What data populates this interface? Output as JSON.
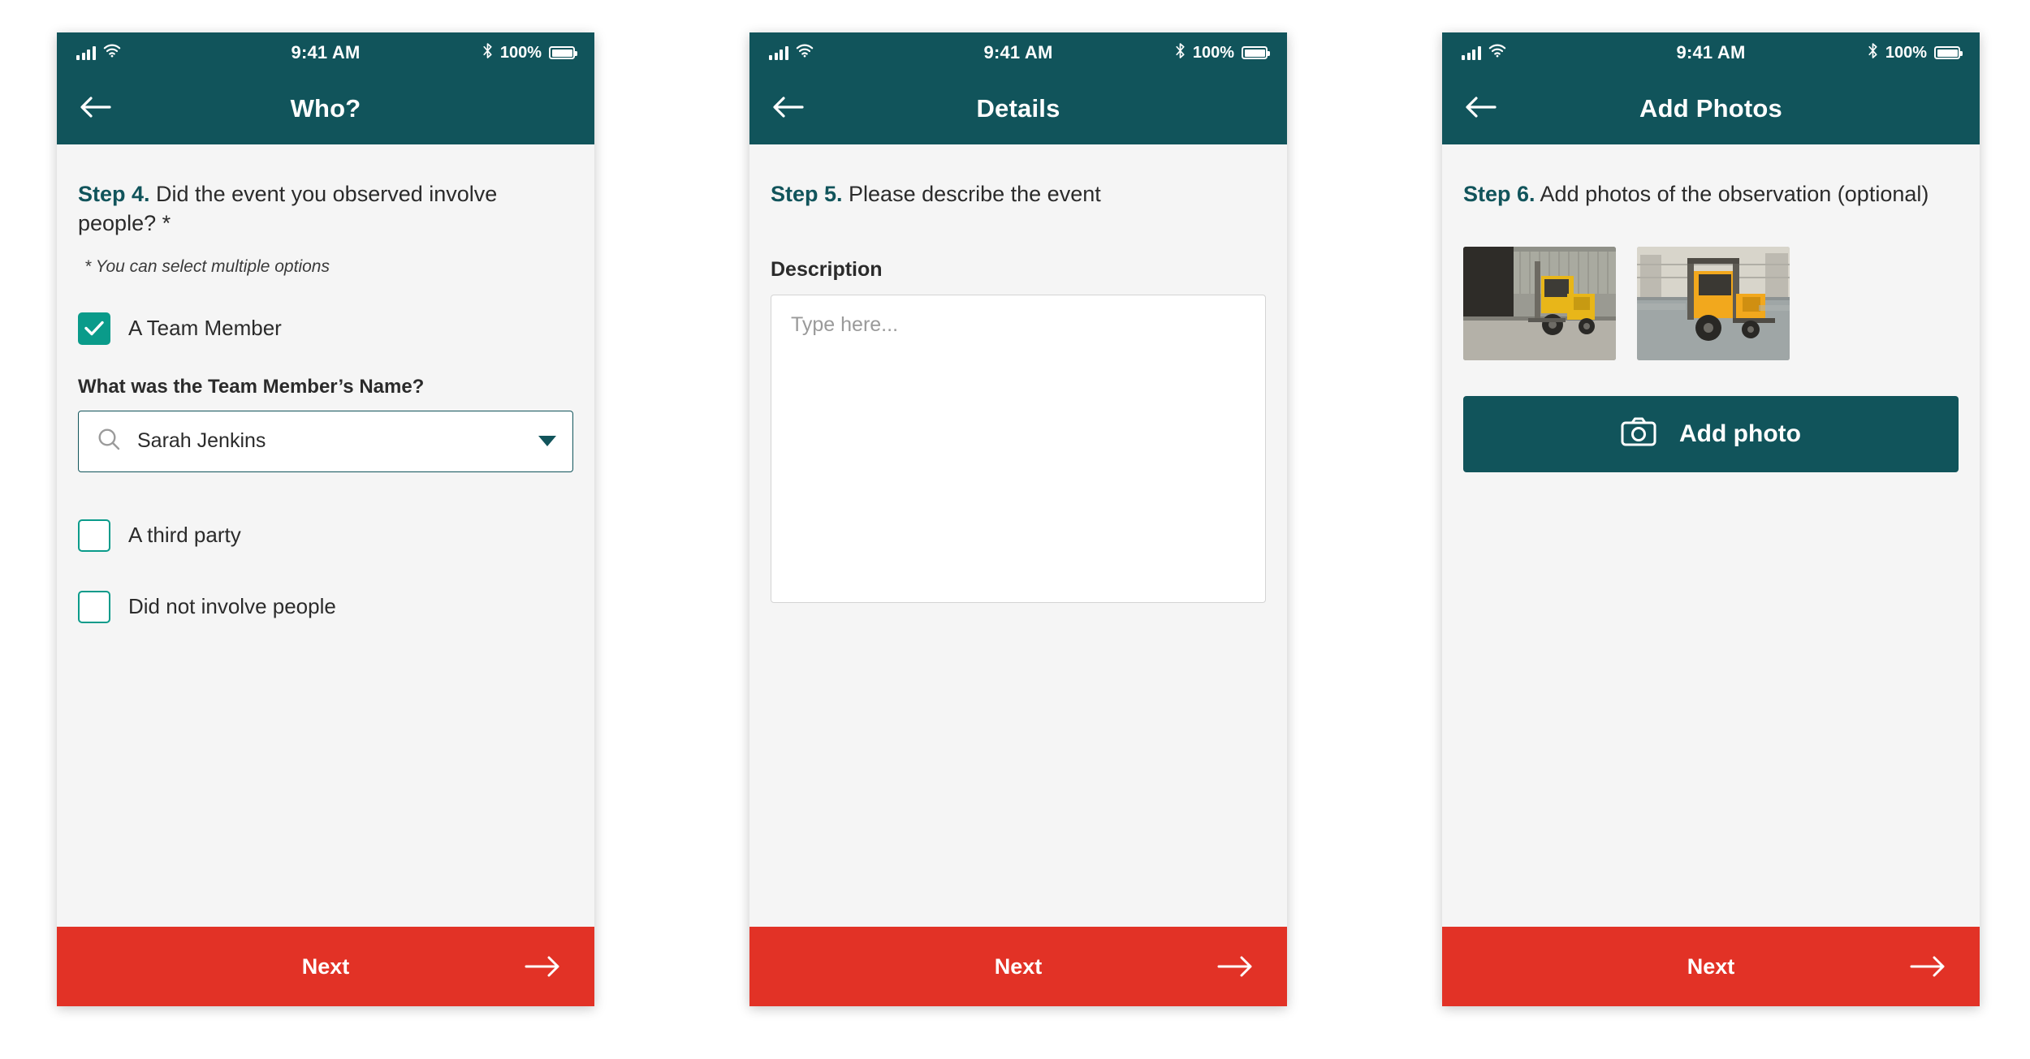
{
  "statusbar": {
    "time": "9:41 AM",
    "battery_percent": "100%",
    "icons": [
      "signal-bars-icon",
      "wifi-icon",
      "bluetooth-icon",
      "battery-icon"
    ]
  },
  "colors": {
    "header": "#11545b",
    "accent_teal": "#0a9b8a",
    "next_button": "#e23226",
    "body_bg": "#f5f5f5"
  },
  "common": {
    "next_label": "Next",
    "back_icon": "arrow-left-icon",
    "next_icon": "arrow-right-icon"
  },
  "screens": [
    {
      "title": "Who?",
      "step_num": "Step 4.",
      "step_text": " Did the event you observed involve people? *",
      "hint": "* You can select multiple options",
      "checkboxes": [
        {
          "label": "A Team Member",
          "checked": true
        },
        {
          "label": "A third party",
          "checked": false
        },
        {
          "label": "Did not involve people",
          "checked": false
        }
      ],
      "field_label": "What was the Team Member’s Name?",
      "select_value": "Sarah Jenkins",
      "select_icon": "search-icon",
      "select_caret": "chevron-down-icon"
    },
    {
      "title": "Details",
      "step_num": "Step 5.",
      "step_text": " Please describe the event",
      "desc_label": "Description",
      "desc_placeholder": "Type here..."
    },
    {
      "title": "Add Photos",
      "step_num": "Step 6.",
      "step_text": " Add photos of the observation (optional)",
      "photos": [
        {
          "name": "forklift-photo-1",
          "alt": "yellow forklift beside loading dock"
        },
        {
          "name": "forklift-photo-2",
          "alt": "yellow forklift inside warehouse"
        }
      ],
      "add_photo_label": "Add photo",
      "add_photo_icon": "camera-icon"
    }
  ]
}
